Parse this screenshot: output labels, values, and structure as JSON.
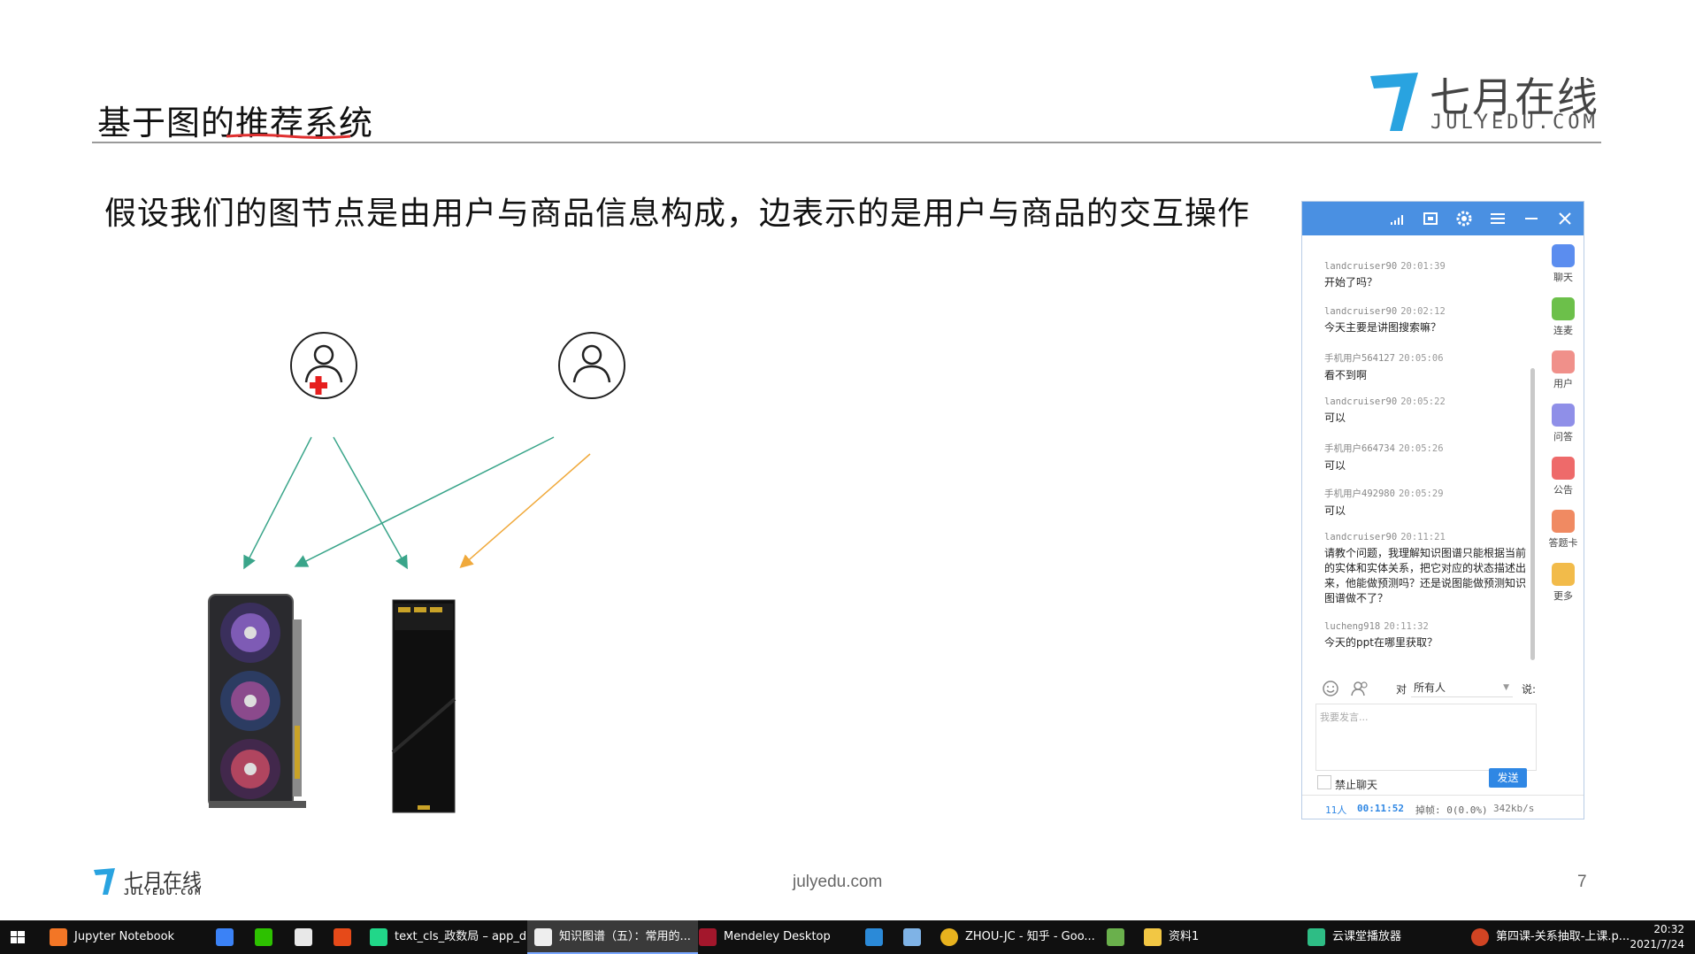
{
  "slide": {
    "title": "基于图的推荐系统",
    "brand_name": "七月在线",
    "brand_domain": "JULYEDU.COM",
    "subtitle": "假设我们的图节点是由用户与商品信息构成，边表示的是用户与商品的交互操作",
    "footer_logo_name": "七月在线",
    "footer_logo_domain": "JULYEDU.COM",
    "footer_url": "julyedu.com",
    "page_number": "7",
    "accent_color": "#29a3e0"
  },
  "diagram": {
    "nodes": [
      {
        "kind": "user",
        "icon": "user-icon",
        "badge": "red-cross"
      },
      {
        "kind": "user",
        "icon": "user-icon"
      },
      {
        "kind": "item",
        "icon": "graphics-card-image"
      },
      {
        "kind": "item",
        "icon": "ssd-image"
      }
    ],
    "edge_colors": {
      "teal": "#3aa58a",
      "orange": "#f0a93b"
    }
  },
  "chat": {
    "messages": [
      {
        "user": "landcruiser90",
        "time": "20:01:39",
        "text": "开始了吗？"
      },
      {
        "user": "landcruiser90",
        "time": "20:02:12",
        "text": "今天主要是讲图搜索嘛？"
      },
      {
        "user": "手机用户564127",
        "time": "20:05:06",
        "text": "看不到啊"
      },
      {
        "user": "landcruiser90",
        "time": "20:05:22",
        "text": "可以"
      },
      {
        "user": "手机用户664734",
        "time": "20:05:26",
        "text": "可以"
      },
      {
        "user": "手机用户492980",
        "time": "20:05:29",
        "text": "可以"
      },
      {
        "user": "landcruiser90",
        "time": "20:11:21",
        "text": "请教个问题，我理解知识图谱只能根据当前的实体和实体关系，把它对应的状态描述出来，他能做预测吗？还是说图能做预测知识图谱做不了？"
      },
      {
        "user": "lucheng918",
        "time": "20:11:32",
        "text": "今天的ppt在哪里获取？"
      }
    ],
    "sidebar": [
      {
        "label": "聊天",
        "icon": "chat-icon",
        "color": "#5b8def"
      },
      {
        "label": "连麦",
        "icon": "mic-link-icon",
        "color": "#6cc04a"
      },
      {
        "label": "用户",
        "icon": "user-icon",
        "color": "#f0908a"
      },
      {
        "label": "问答",
        "icon": "question-icon",
        "color": "#8f8fe8"
      },
      {
        "label": "公告",
        "icon": "notice-icon",
        "color": "#ee6a6a"
      },
      {
        "label": "答题卡",
        "icon": "answer-card-icon",
        "color": "#f08a62"
      },
      {
        "label": "更多",
        "icon": "more-icon",
        "color": "#f2bb4a"
      }
    ],
    "to_label": "对",
    "audience": "所有人",
    "say_label": "说:",
    "input_placeholder": "我要发言...",
    "mute_label": "禁止聊天",
    "send_label": "发送",
    "status": {
      "count": "11人",
      "time": "00:11:52",
      "lost": "掉帧: 0(0.0%)",
      "rate": "342kb/s"
    }
  },
  "taskbar": {
    "items": [
      {
        "label": "Jupyter Notebook",
        "icon": "jupyter-icon",
        "color": "#f37626"
      },
      {
        "label": "",
        "icon": "feishu-icon",
        "color": "#3b82f6"
      },
      {
        "label": "",
        "icon": "wechat-icon",
        "color": "#2dc100"
      },
      {
        "label": "",
        "icon": "qq-icon",
        "color": "#e8e8e8"
      },
      {
        "label": "",
        "icon": "netease-icon",
        "color": "#e64a19"
      },
      {
        "label": "text_cls_政数局 – app_d...",
        "icon": "pycharm-icon",
        "color": "#21d789"
      },
      {
        "label": "知识图谱（五）：常用的...",
        "icon": "typora-icon",
        "color": "#eeeeee"
      },
      {
        "label": "Mendeley Desktop",
        "icon": "mendeley-icon",
        "color": "#a3172c"
      },
      {
        "label": "",
        "icon": "vscode-icon",
        "color": "#2b8ad8"
      },
      {
        "label": "",
        "icon": "remote-desktop-icon",
        "color": "#7fb3e6"
      },
      {
        "label": "ZHOU-JC - 知乎 - Goo...",
        "icon": "chrome-icon",
        "color": "#e8b21e"
      },
      {
        "label": "",
        "icon": "wallet-icon",
        "color": "#6ab04c"
      },
      {
        "label": "资料1",
        "icon": "folder-icon",
        "color": "#f2c744"
      },
      {
        "label": "云课堂播放器",
        "icon": "classroom-icon",
        "color": "#2ebd85"
      },
      {
        "label": "第四课-关系抽取-上课.p...",
        "icon": "powerpoint-icon",
        "color": "#d04423"
      }
    ],
    "clock_time": "20:32",
    "clock_date": "2021/7/24"
  }
}
